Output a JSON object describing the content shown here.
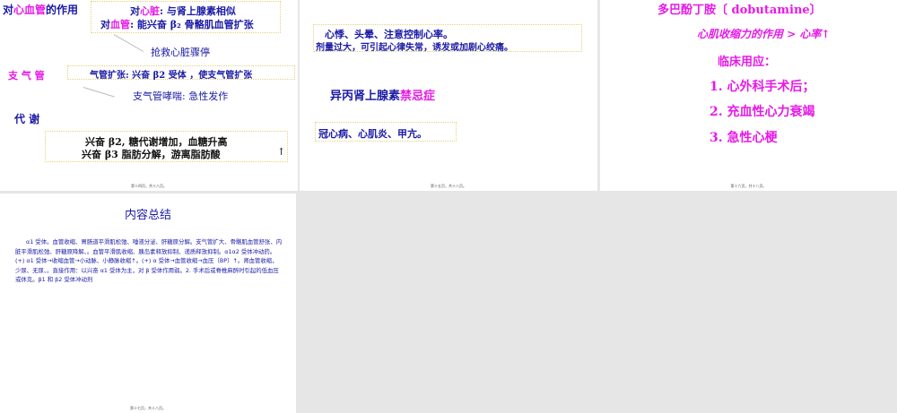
{
  "slide1": {
    "title_a": "对",
    "title_b": "心血管",
    "title_c": "的作用",
    "heart_a": "对",
    "heart_b": "心脏",
    "heart_c": ": 与肾上腺素相似",
    "vessel_a": "对",
    "vessel_b": "血管",
    "vessel_c": ": 能兴奋 β₂ 骨骼肌血管扩张",
    "note1": "抢救心脏骤停",
    "bronchus": "支 气 管",
    "bronchus_box": "气管扩张: 兴奋  β2 受体 ，使支气管扩张",
    "note2": "支气管哮喘: 急性发作",
    "metab": "代 谢",
    "metab1": "兴奋 β2, 糖代谢增加，血糖升高",
    "metab2": "兴奋    β3  脂肪分解，游离脂肪酸",
    "arrow": "↑",
    "footer": "第十四页，共十八页。"
  },
  "slide2": {
    "box1_l1": "心悸、头晕、注意控制心率。",
    "box1_l2": "剂量过大，可引起心律失常，诱发或加剧心绞痛。",
    "heading_a": "异丙肾上腺素",
    "heading_b": "禁忌症",
    "box2": "冠心病、心肌炎、甲亢。",
    "footer": "第十五页，共十八页。"
  },
  "slide3": {
    "title": "多巴酚丁胺〔 dobutamine〕",
    "line1": "心肌收缩力的作用 >  心率",
    "arrow": "↑",
    "line2": "临床用应：",
    "item1": "1. 心外科手术后；",
    "item2": "2. 充血性心力衰竭",
    "item3": "3. 急性心梗",
    "footer": "第十六页，共十八页。"
  },
  "slide4": {
    "title": "内容总结",
    "body": "α1 受体。血管收缩、胃肠道平滑肌松弛、唾液分泌、肝糖原分解。支气管扩大、骨骼肌血管舒张、内脏平滑肌松弛、肝糖原降解、。血管平滑肌收缩、胰岛素释放抑制、递质释放抑制。α1α2 受体冲动药。(+) α1 受体→收缩血管→小动脉、小静脉收缩↑。(+) α 受体→血管收缩→血压〔BP〕↑。肾血管收缩，少尿、无尿、。直接作用：以兴奋 α1 受体为主，对 β 受体作用弱。2. 手术后或脊椎麻醉时引起的低血压或休克。β1 和 β2 受体冲动剂",
    "footer": "第十七页，共十八页。"
  }
}
